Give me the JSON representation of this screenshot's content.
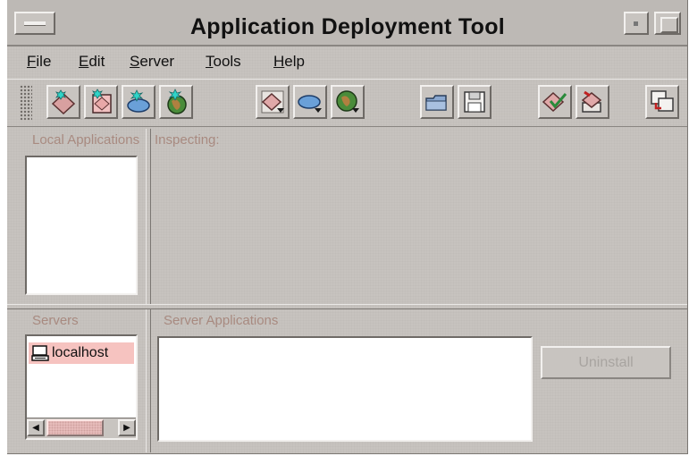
{
  "window": {
    "title": "Application Deployment Tool"
  },
  "menubar": {
    "items": [
      {
        "label": "File",
        "mnemonic": "F",
        "rest": "ile"
      },
      {
        "label": "Edit",
        "mnemonic": "E",
        "rest": "dit"
      },
      {
        "label": "Server",
        "mnemonic": "S",
        "rest": "erver"
      },
      {
        "label": "Tools",
        "mnemonic": "T",
        "rest": "ools"
      },
      {
        "label": "Help",
        "mnemonic": "H",
        "rest": "elp"
      }
    ]
  },
  "toolbar": {
    "icons": [
      "new-application-icon",
      "new-ejb-icon",
      "new-component-icon",
      "new-web-component-icon",
      "add-application-icon",
      "add-component-icon",
      "add-web-component-icon",
      "open-folder-icon",
      "save-icon",
      "verify-icon",
      "deploy-icon",
      "update-files-icon"
    ]
  },
  "panes": {
    "local_applications_label": "Local Applications",
    "inspecting_label": "Inspecting:",
    "servers_label": "Servers",
    "server_applications_label": "Server Applications"
  },
  "servers": {
    "items": [
      {
        "name": "localhost"
      }
    ]
  },
  "actions": {
    "uninstall_label": "Uninstall"
  },
  "colors": {
    "window_bg": "#c8c4c0",
    "label_text": "#a88a80",
    "selection": "#f6c3c0",
    "disabled_text": "#a8a4a0"
  }
}
